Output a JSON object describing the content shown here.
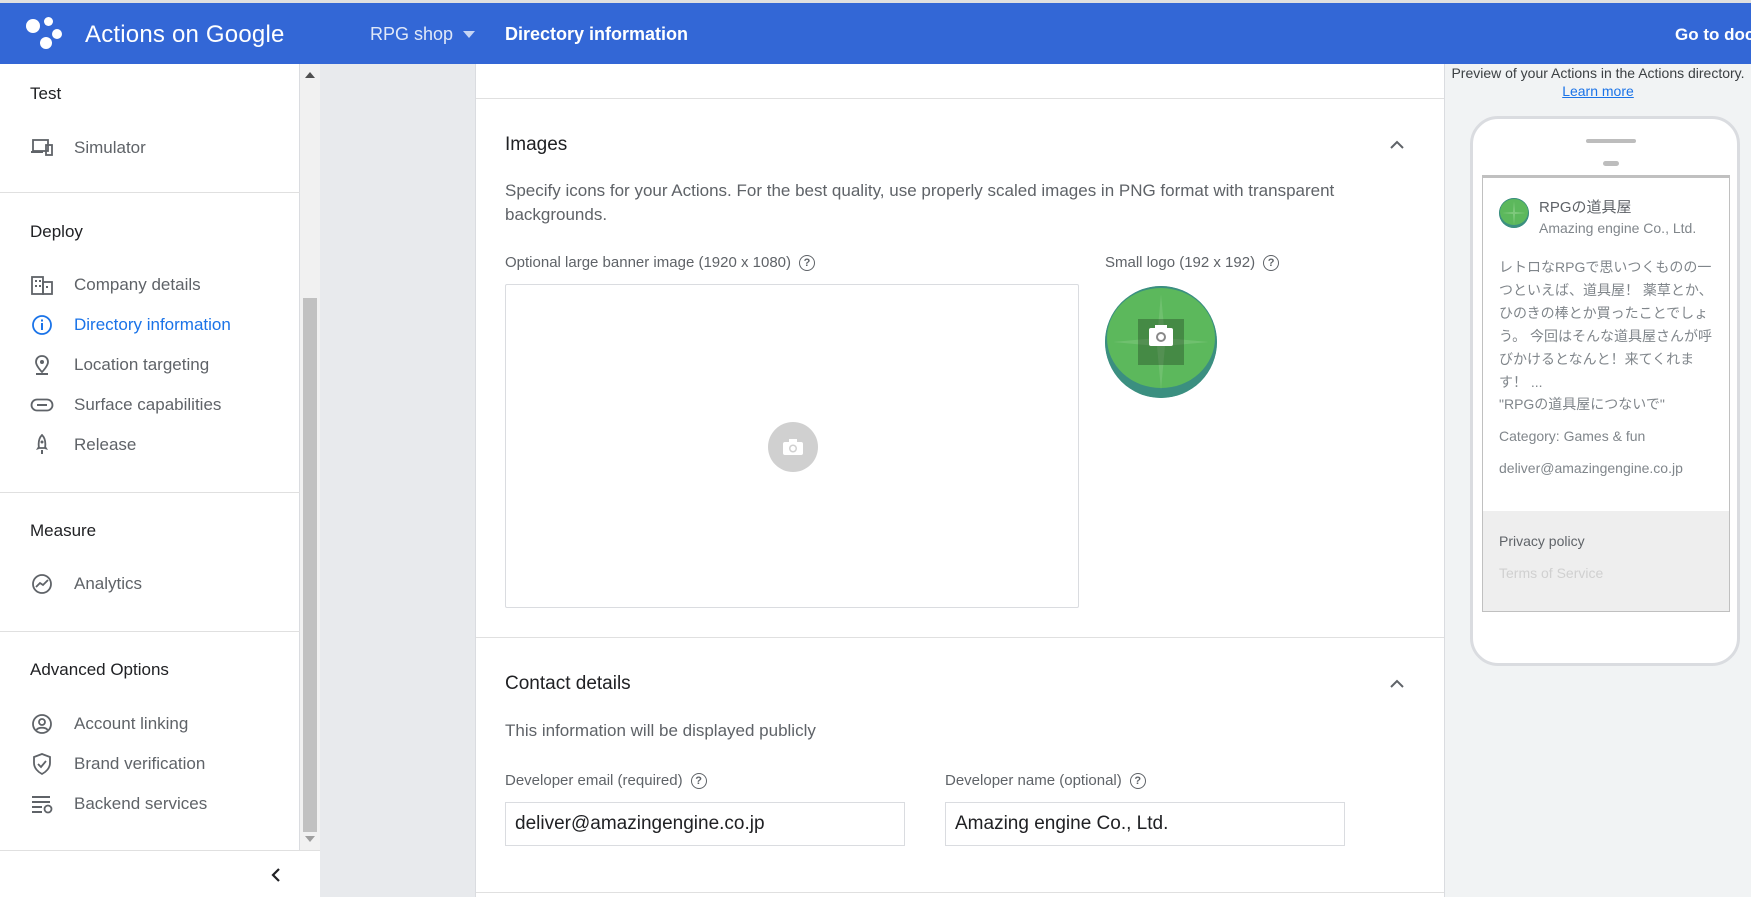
{
  "header": {
    "app_title": "Actions on Google",
    "project_name": "RPG shop",
    "breadcrumb": "Directory information",
    "go_to_docs": "Go to doc"
  },
  "sidebar": {
    "test": {
      "title": "Test",
      "items": [
        {
          "label": "Simulator",
          "icon": "devices-icon"
        }
      ]
    },
    "deploy": {
      "title": "Deploy",
      "items": [
        {
          "label": "Company details",
          "icon": "building-icon"
        },
        {
          "label": "Directory information",
          "icon": "info-icon",
          "active": true
        },
        {
          "label": "Location targeting",
          "icon": "location-pin-icon"
        },
        {
          "label": "Surface capabilities",
          "icon": "toggle-icon"
        },
        {
          "label": "Release",
          "icon": "rocket-icon"
        }
      ]
    },
    "measure": {
      "title": "Measure",
      "items": [
        {
          "label": "Analytics",
          "icon": "analytics-icon"
        }
      ]
    },
    "advanced": {
      "title": "Advanced Options",
      "items": [
        {
          "label": "Account linking",
          "icon": "account-circle-icon"
        },
        {
          "label": "Brand verification",
          "icon": "verified-shield-icon"
        },
        {
          "label": "Backend services",
          "icon": "settings-list-icon"
        }
      ]
    }
  },
  "images": {
    "title": "Images",
    "description": "Specify icons for your Actions. For the best quality, use properly scaled images in PNG format with transparent backgrounds.",
    "banner_label": "Optional large banner image (1920 x 1080)",
    "logo_label": "Small logo (192 x 192)"
  },
  "contact": {
    "title": "Contact details",
    "description": "This information will be displayed publicly",
    "email_label": "Developer email (required)",
    "email_value": "deliver@amazingengine.co.jp",
    "name_label": "Developer name (optional)",
    "name_value": "Amazing engine Co., Ltd."
  },
  "preview": {
    "header_text": "Preview of your Actions in the Actions directory.",
    "learn_more": "Learn more",
    "action_name": "RPGの道具屋",
    "developer": "Amazing engine Co., Ltd.",
    "description": "レトロなRPGで思いつくものの一つといえば、道具屋！ 薬草とか、ひのきの棒とか買ったことでしょう。 今回はそんな道具屋さんが呼びかけるとなんと！来てくれます！ ...",
    "invocation": "\"RPGの道具屋につないで\"",
    "category": "Category: Games & fun",
    "email": "deliver@amazingengine.co.jp",
    "privacy_policy": "Privacy policy",
    "terms": "Terms of Service"
  },
  "colors": {
    "brand_blue": "#3367d6",
    "active_blue": "#1a73e8",
    "logo_green": "#5cb85c",
    "logo_teal": "#3b8f80"
  }
}
